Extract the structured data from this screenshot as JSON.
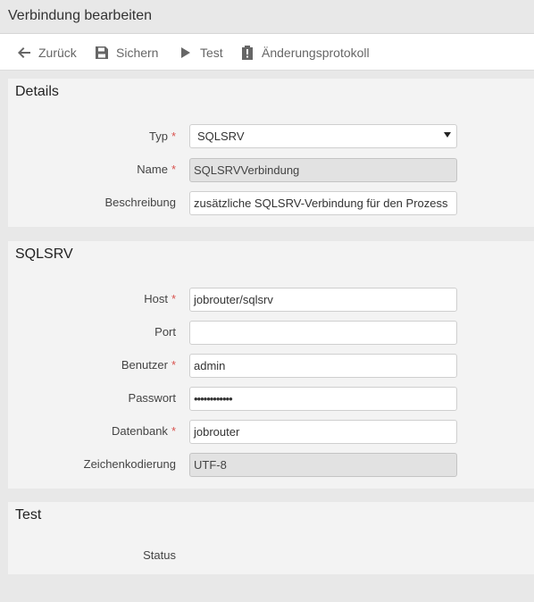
{
  "header": {
    "title": "Verbindung bearbeiten"
  },
  "toolbar": {
    "back_label": "Zurück",
    "save_label": "Sichern",
    "test_label": "Test",
    "log_label": "Änderungsprotokoll"
  },
  "details": {
    "title": "Details",
    "type_label": "Typ",
    "type_value": "SQLSRV",
    "name_label": "Name",
    "name_value": "SQLSRVVerbindung",
    "description_label": "Beschreibung",
    "description_value": "zusätzliche SQLSRV-Verbindung für den Prozess"
  },
  "sqlsrv": {
    "title": "SQLSRV",
    "host_label": "Host",
    "host_value": "jobrouter/sqlsrv",
    "port_label": "Port",
    "port_value": "",
    "user_label": "Benutzer",
    "user_value": "admin",
    "password_label": "Passwort",
    "password_value": "••••••••••••",
    "database_label": "Datenbank",
    "database_value": "jobrouter",
    "encoding_label": "Zeichenkodierung",
    "encoding_value": "UTF-8"
  },
  "test": {
    "title": "Test",
    "status_label": "Status",
    "status_value": ""
  },
  "required_marker": "*"
}
